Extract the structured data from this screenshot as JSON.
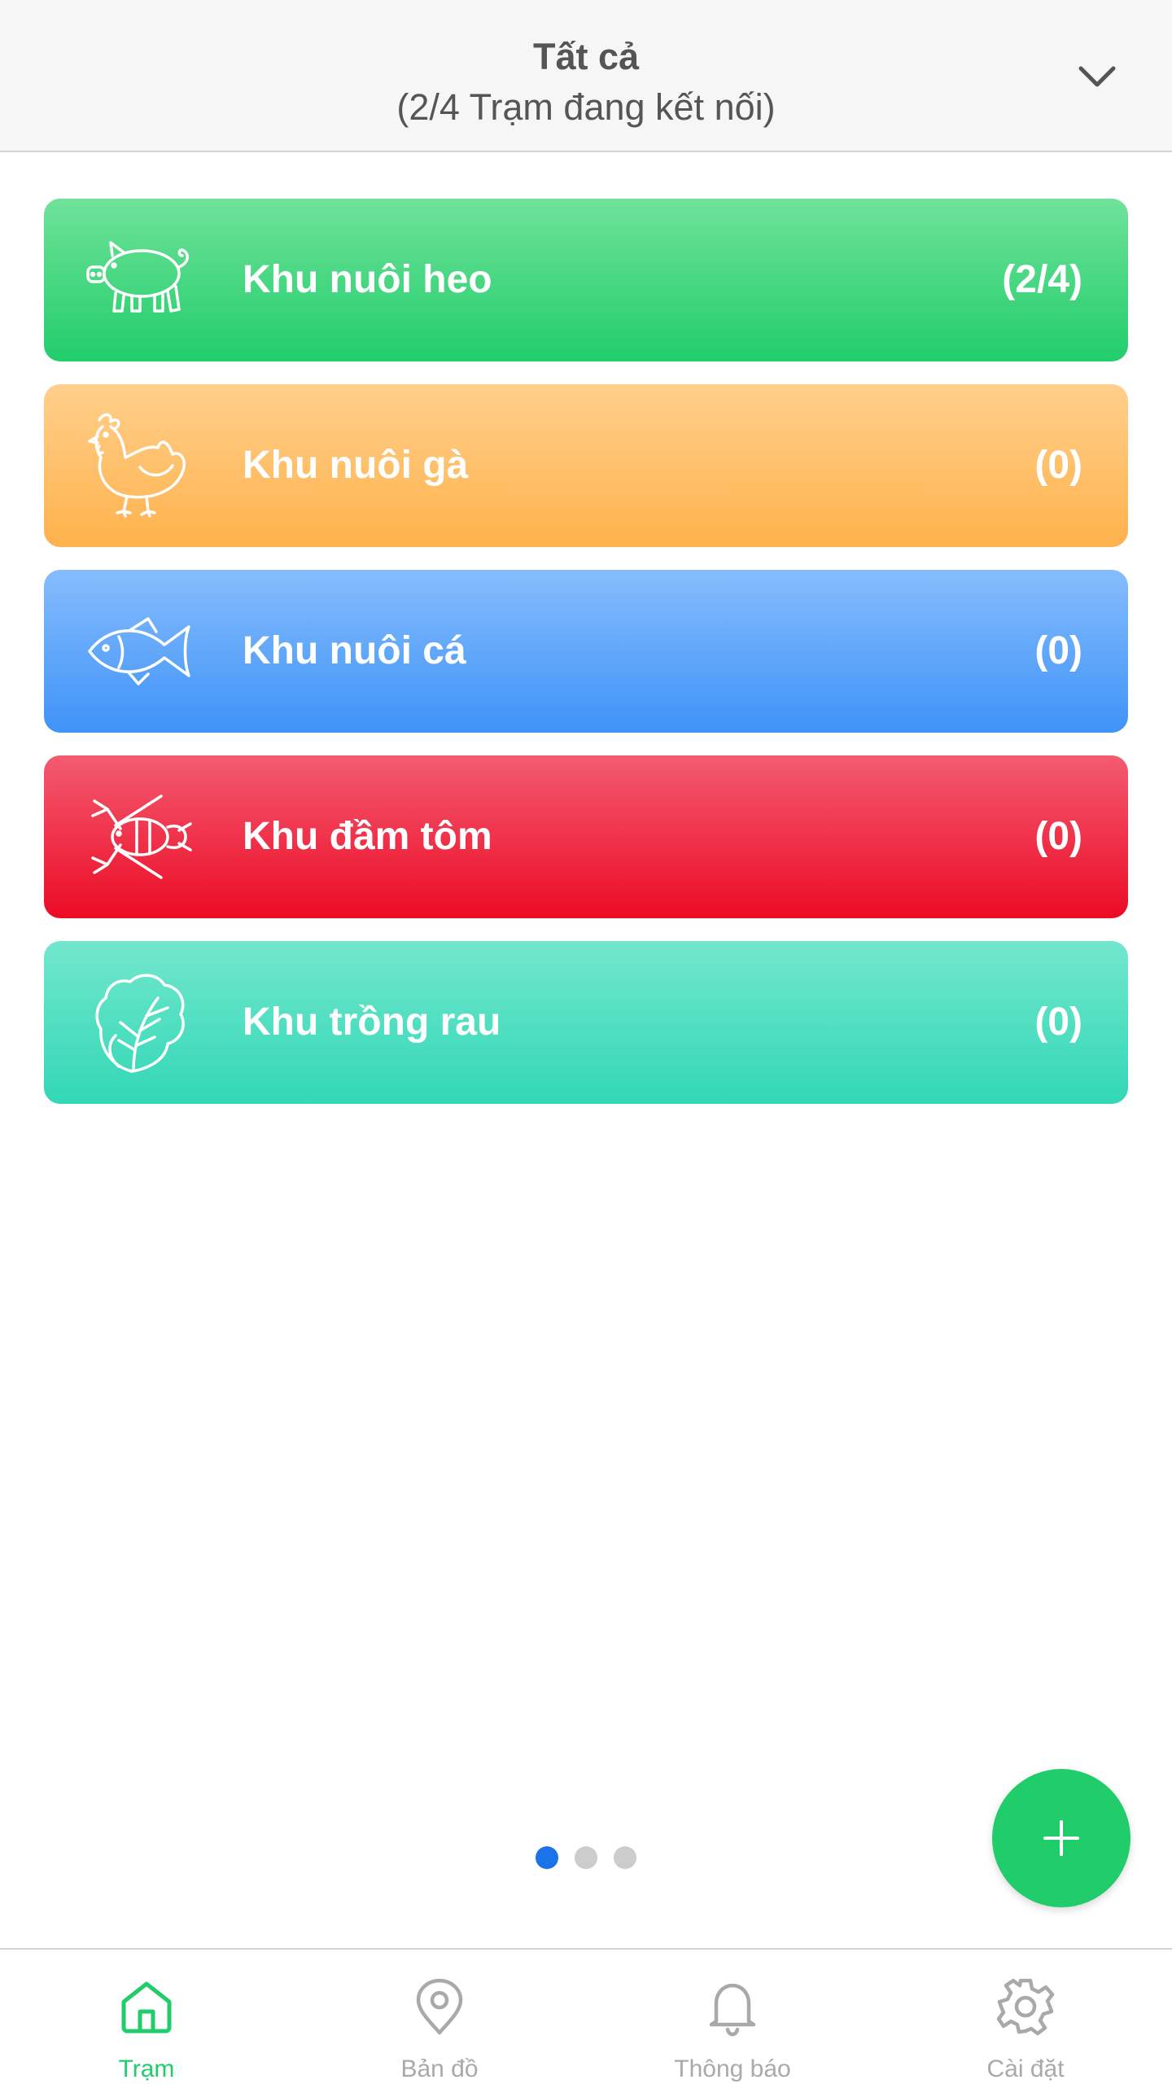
{
  "header": {
    "title": "Tất cả",
    "subtitle": "(2/4 Trạm đang kết nối)",
    "dropdown_icon": "chevron-down-icon"
  },
  "zones": [
    {
      "label": "Khu nuôi heo",
      "count": "(2/4)",
      "icon": "pig-icon",
      "color": "#22cd6b"
    },
    {
      "label": "Khu nuôi gà",
      "count": "(0)",
      "icon": "chicken-icon",
      "color": "#ffb24c"
    },
    {
      "label": "Khu nuôi cá",
      "count": "(0)",
      "icon": "fish-icon",
      "color": "#3f93f8"
    },
    {
      "label": "Khu đầm tôm",
      "count": "(0)",
      "icon": "lobster-icon",
      "color": "#ec0b25"
    },
    {
      "label": "Khu trồng rau",
      "count": "(0)",
      "icon": "lettuce-icon",
      "color": "#32d7b6"
    }
  ],
  "pager": {
    "pages": 3,
    "current": 1,
    "active_color": "#1a73e8"
  },
  "fab": {
    "icon": "plus-icon",
    "color": "#21cc6b"
  },
  "nav": {
    "items": [
      {
        "label": "Trạm",
        "icon": "home-icon",
        "active": true
      },
      {
        "label": "Bản đồ",
        "icon": "map-pin-icon",
        "active": false
      },
      {
        "label": "Thông báo",
        "icon": "bell-icon",
        "active": false
      },
      {
        "label": "Cài đặt",
        "icon": "gear-icon",
        "active": false
      }
    ],
    "active_color": "#21cc6b",
    "inactive_color": "#a9a9a9"
  }
}
